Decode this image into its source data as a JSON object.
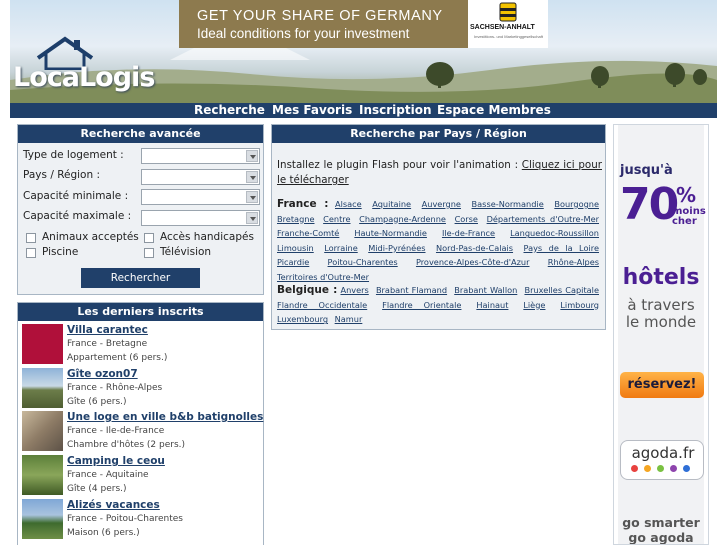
{
  "header": {
    "logo_text": "LocaLogis",
    "banner": {
      "line1": "GET YOUR SHARE OF GERMANY",
      "line2": "Ideal conditions for your investment",
      "sponsor": "SACHSEN-ANHALT",
      "sponsor_tagline": "Investitions- und Marketinggesellschaft"
    }
  },
  "nav": {
    "items": [
      "Recherche",
      "Mes Favoris",
      "Inscription",
      "Espace Membres"
    ]
  },
  "search": {
    "title": "Recherche avancée",
    "fields": [
      {
        "label": "Type de logement :",
        "value": ""
      },
      {
        "label": "Pays / Région :",
        "value": ""
      },
      {
        "label": "Capacité minimale :",
        "value": ""
      },
      {
        "label": "Capacité maximale :",
        "value": ""
      }
    ],
    "checkboxes": [
      {
        "label": "Animaux acceptés",
        "checked": false
      },
      {
        "label": "Accès handicapés",
        "checked": false
      },
      {
        "label": "Piscine",
        "checked": false
      },
      {
        "label": "Télévision",
        "checked": false
      }
    ],
    "button_label": "Rechercher"
  },
  "recent": {
    "title": "Les derniers inscrits",
    "items": [
      {
        "title": "Villa carantec",
        "location": "France - Bretagne",
        "type": "Appartement (6 pers.)"
      },
      {
        "title": "Gîte ozon07",
        "location": "France - Rhône-Alpes",
        "type": "Gîte (6 pers.)"
      },
      {
        "title": "Une loge en ville b&b batignolles",
        "location": "France - Ile-de-France",
        "type": "Chambre d'hôtes (2 pers.)"
      },
      {
        "title": "Camping le ceou",
        "location": "France - Aquitaine",
        "type": "Gîte (4 pers.)"
      },
      {
        "title": "Alizés vacances",
        "location": "France - Poitou-Charentes",
        "type": "Maison (6 pers.)"
      }
    ]
  },
  "countries": {
    "title": "Recherche par Pays / Région",
    "flash_text": "Installez le plugin Flash pour voir l'animation : ",
    "flash_link": "Cliquez ici pour le télécharger",
    "groups": [
      {
        "country": "France :",
        "regions": [
          "Alsace",
          "Aquitaine",
          "Auvergne",
          "Basse-Normandie",
          "Bourgogne",
          "Bretagne",
          "Centre",
          "Champagne-Ardenne",
          "Corse",
          "Départements d'Outre-Mer",
          "Franche-Comté",
          "Haute-Normandie",
          "Ile-de-France",
          "Languedoc-Roussillon",
          "Limousin",
          "Lorraine",
          "Midi-Pyrénées",
          "Nord-Pas-de-Calais",
          "Pays de la Loire",
          "Picardie",
          "Poitou-Charentes",
          "Provence-Alpes-Côte-d'Azur",
          "Rhône-Alpes",
          "Territoires d'Outre-Mer"
        ]
      },
      {
        "country": "Belgique :",
        "regions": [
          "Anvers",
          "Brabant Flamand",
          "Brabant Wallon",
          "Bruxelles Capitale",
          "Flandre Occidentale",
          "Flandre Orientale",
          "Hainaut",
          "Liège",
          "Limbourg",
          "Luxembourg",
          "Namur"
        ]
      }
    ]
  },
  "ad": {
    "upto": "jusqu'à",
    "percent": "70",
    "percent_sign": "%",
    "moins": "moins",
    "cher": "cher",
    "hotels": "hôtels",
    "travers_1": "à travers",
    "travers_2": "le monde",
    "button": "réservez!",
    "brand": "agoda.fr",
    "slogan_1": "go smarter",
    "slogan_2": "go agoda",
    "dot_colors": [
      "#e8423f",
      "#f5a623",
      "#7ac142",
      "#8e44ad",
      "#2f6fd6"
    ]
  }
}
